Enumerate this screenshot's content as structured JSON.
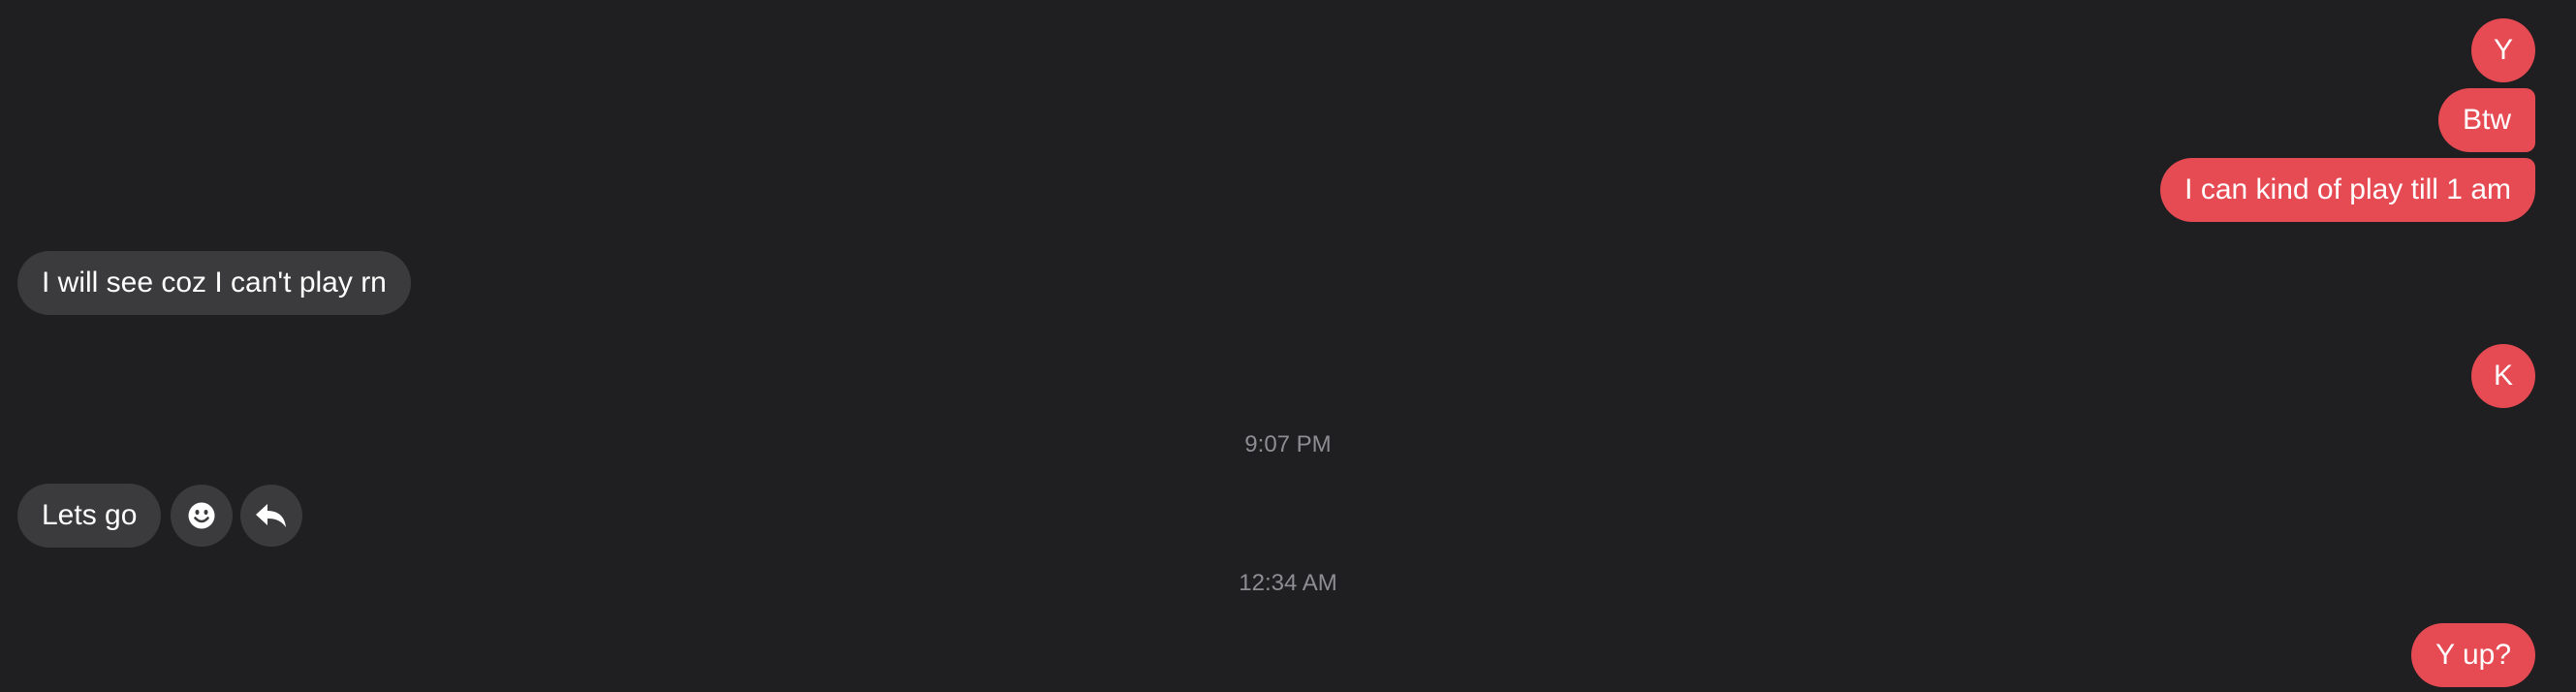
{
  "messages": [
    {
      "text": "Y",
      "direction": "outgoing"
    },
    {
      "text": "Btw",
      "direction": "outgoing"
    },
    {
      "text": "I can kind of play till 1 am",
      "direction": "outgoing"
    },
    {
      "text": "I will see coz I can't play rn",
      "direction": "incoming"
    },
    {
      "text": "K",
      "direction": "outgoing"
    },
    {
      "text": "Lets go",
      "direction": "incoming"
    },
    {
      "text": "Y up?",
      "direction": "outgoing"
    }
  ],
  "timestamps": [
    "9:07 PM",
    "12:34 AM"
  ],
  "actions": [
    {
      "icon": "smiley-icon",
      "label": "React"
    },
    {
      "icon": "reply-icon",
      "label": "Reply"
    }
  ],
  "colors": {
    "background": "#1f1f21",
    "outgoing_bubble": "#e64b53",
    "incoming_bubble": "#3b3b3d",
    "timestamp_text": "#8e8e92"
  }
}
